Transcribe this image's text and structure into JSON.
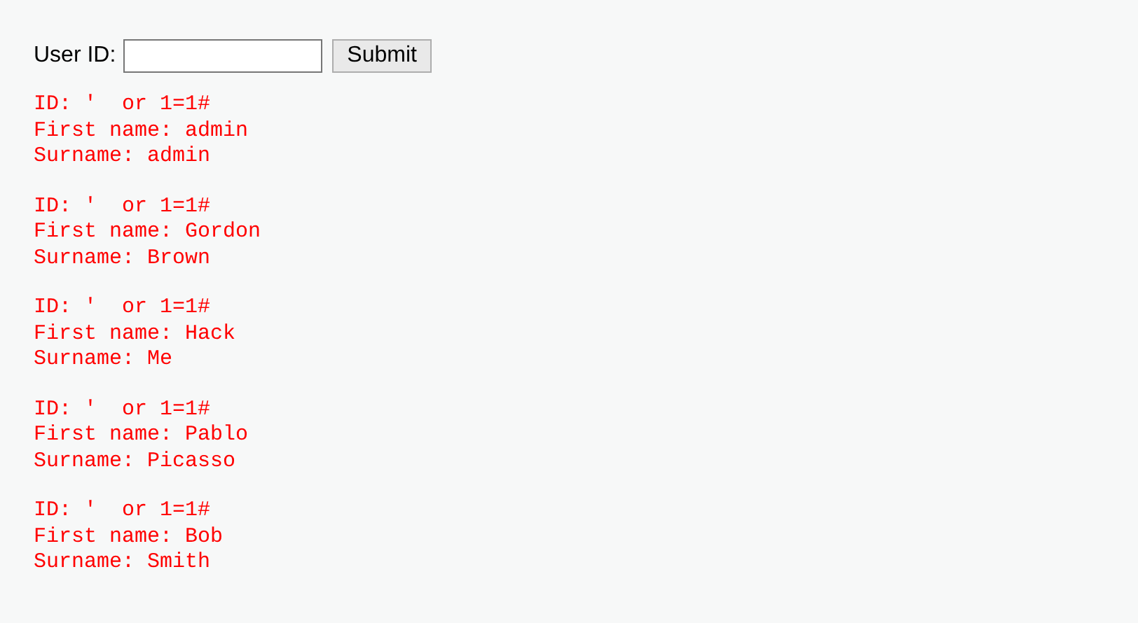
{
  "form": {
    "label": "User ID:",
    "submit": "Submit"
  },
  "results": [
    {
      "lines": [
        "ID: '  or 1=1#",
        "First name: admin",
        "Surname: admin"
      ]
    },
    {
      "lines": [
        "ID: '  or 1=1#",
        "First name: Gordon",
        "Surname: Brown"
      ]
    },
    {
      "lines": [
        "ID: '  or 1=1#",
        "First name: Hack",
        "Surname: Me"
      ]
    },
    {
      "lines": [
        "ID: '  or 1=1#",
        "First name: Pablo",
        "Surname: Picasso"
      ]
    },
    {
      "lines": [
        "ID: '  or 1=1#",
        "First name: Bob",
        "Surname: Smith"
      ]
    }
  ]
}
